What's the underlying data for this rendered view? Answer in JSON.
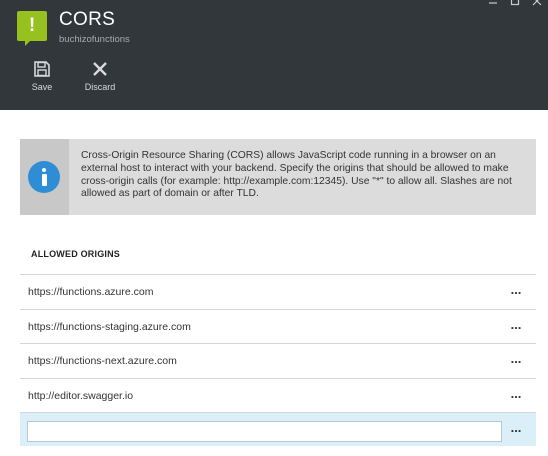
{
  "header": {
    "title": "CORS",
    "subtitle": "buchizofunctions",
    "icon": "exclamation-icon",
    "background": "#32373c",
    "accent": "#97c11f"
  },
  "toolbar": {
    "save_label": "Save",
    "discard_label": "Discard"
  },
  "info": {
    "icon": "info-icon",
    "text": "Cross-Origin Resource Sharing (CORS) allows JavaScript code running in a browser on an external host to interact with your backend. Specify the origins that should be allowed to make cross-origin calls (for example: http://example.com:12345). Use \"*\" to allow all. Slashes are not allowed as part of domain or after TLD."
  },
  "origins": {
    "header": "ALLOWED ORIGINS",
    "more_label": "...",
    "items": [
      "https://functions.azure.com",
      "https://functions-staging.azure.com",
      "https://functions-next.azure.com",
      "http://editor.swagger.io"
    ],
    "new_value": "",
    "new_row_color": "#dbeff9"
  }
}
